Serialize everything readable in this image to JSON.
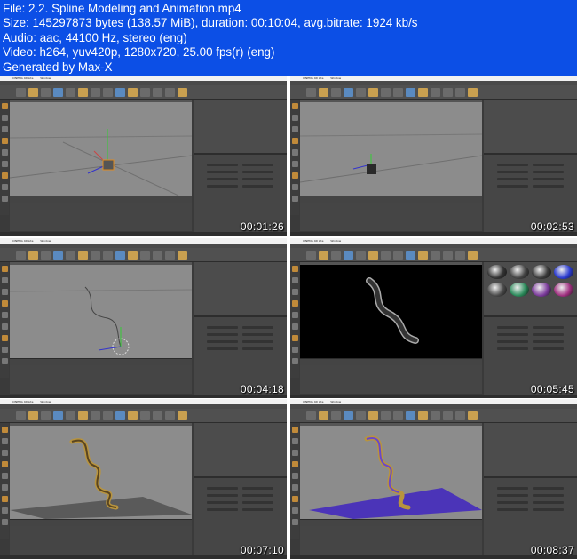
{
  "header": {
    "file": "File: 2.2. Spline Modeling and Animation.mp4",
    "size": "Size: 145297873 bytes (138.57 MiB), duration: 00:10:04, avg.bitrate: 1924 kb/s",
    "audio": "Audio: aac, 44100 Hz, stereo (eng)",
    "video": "Video: h264, yuv420p, 1280x720, 25.00 fps(r) (eng)",
    "generator": "Generated by Max-X"
  },
  "app": {
    "name": "CINEMA 4D Lite",
    "menu": "Window"
  },
  "colors": {
    "header_bg": "#0c4fe6",
    "accent_orange": "#e08a20",
    "gold": "#b8943e"
  },
  "thumbnails": [
    {
      "timestamp": "00:01:26",
      "scene": "cube"
    },
    {
      "timestamp": "00:02:53",
      "scene": "cube-dark"
    },
    {
      "timestamp": "00:04:18",
      "scene": "spline"
    },
    {
      "timestamp": "00:05:45",
      "scene": "render"
    },
    {
      "timestamp": "00:07:10",
      "scene": "helix-gold"
    },
    {
      "timestamp": "00:08:37",
      "scene": "helix-floor"
    }
  ]
}
